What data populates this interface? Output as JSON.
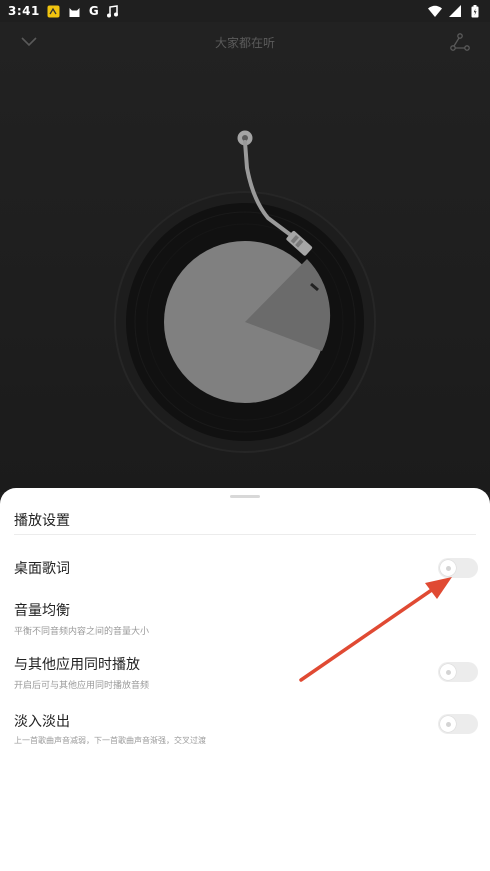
{
  "status_bar": {
    "time": "3:41",
    "g_label": "G",
    "icons": [
      "notification-icon",
      "cat-icon",
      "g-icon",
      "music-note-icon",
      "wifi-icon",
      "signal-icon",
      "battery-icon"
    ]
  },
  "player": {
    "title": "大家都在听",
    "icons": [
      "chevron-down-icon",
      "share-icon"
    ],
    "colors": {
      "disc_outer": "#0f0f0f",
      "disc_label": "#808080",
      "label_shade": "#6a6a6a",
      "tonearm": "#9a9a9a"
    }
  },
  "sheet": {
    "title": "播放设置",
    "settings": [
      {
        "label": "桌面歌词",
        "desc": "",
        "toggle": false
      },
      {
        "label": "音量均衡",
        "desc": "平衡不同音频内容之间的音量大小",
        "toggle": null
      },
      {
        "label": "与其他应用同时播放",
        "desc": "开启后可与其他应用同时播放音频",
        "toggle": false
      },
      {
        "label": "淡入淡出",
        "desc": "上一首歌曲声音减弱，下一首歌曲声音渐强，交叉过渡",
        "toggle": false
      }
    ]
  },
  "annotation": {
    "color": "#e04a33",
    "icon": "red-arrow-icon"
  }
}
